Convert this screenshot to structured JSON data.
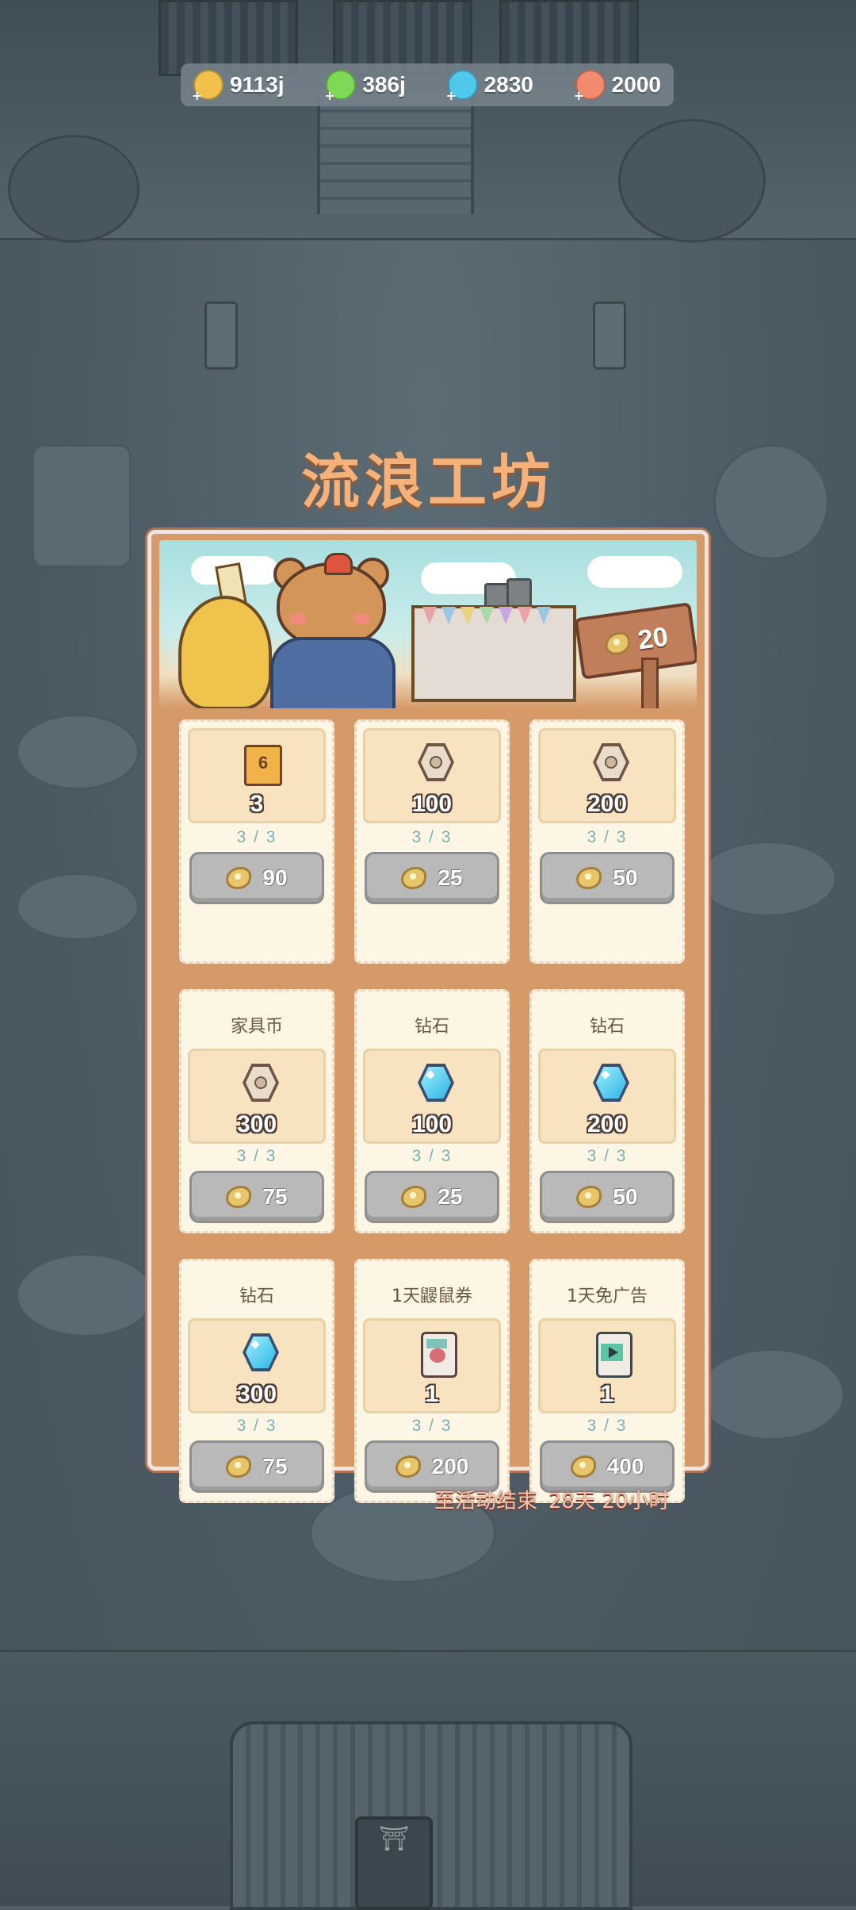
{
  "resources": [
    {
      "icon": "gold-coin-icon",
      "color": "#f2c14d",
      "value": "9113j"
    },
    {
      "icon": "lightning-icon",
      "color": "#7ed957",
      "value": "386j"
    },
    {
      "icon": "diamond-icon",
      "color": "#4fc8ec",
      "value": "2830"
    },
    {
      "icon": "fish-cake-icon",
      "color": "#f28a6e",
      "value": "2000"
    }
  ],
  "title": "流浪工坊",
  "banner": {
    "currency_icon": "gear-currency-icon",
    "currency_amount": "20"
  },
  "items": [
    {
      "name": "",
      "icon": "ticket-icon",
      "icon_text": "6",
      "quantity": "3",
      "stock": "3 / 3",
      "price": "90"
    },
    {
      "name": "",
      "icon": "furniture-coin-icon",
      "icon_text": "",
      "quantity": "100",
      "stock": "3 / 3",
      "price": "25"
    },
    {
      "name": "",
      "icon": "furniture-coin-icon",
      "icon_text": "",
      "quantity": "200",
      "stock": "3 / 3",
      "price": "50"
    },
    {
      "name": "家具币",
      "icon": "furniture-coin-icon",
      "icon_text": "",
      "quantity": "300",
      "stock": "3 / 3",
      "price": "75"
    },
    {
      "name": "钻石",
      "icon": "diamond-icon",
      "icon_text": "",
      "quantity": "100",
      "stock": "3 / 3",
      "price": "25"
    },
    {
      "name": "钻石",
      "icon": "diamond-icon",
      "icon_text": "",
      "quantity": "200",
      "stock": "3 / 3",
      "price": "50"
    },
    {
      "name": "钻石",
      "icon": "diamond-icon",
      "icon_text": "",
      "quantity": "300",
      "stock": "3 / 3",
      "price": "75"
    },
    {
      "name": "1天鼹鼠券",
      "icon": "mole-ticket-icon",
      "icon_text": "",
      "quantity": "1",
      "stock": "3 / 3",
      "price": "200"
    },
    {
      "name": "1天免广告",
      "icon": "no-ad-ticket-icon",
      "icon_text": "",
      "quantity": "1",
      "stock": "3 / 3",
      "price": "400"
    }
  ],
  "timer": {
    "label": "至活动结束",
    "value": "28天 20小时"
  }
}
